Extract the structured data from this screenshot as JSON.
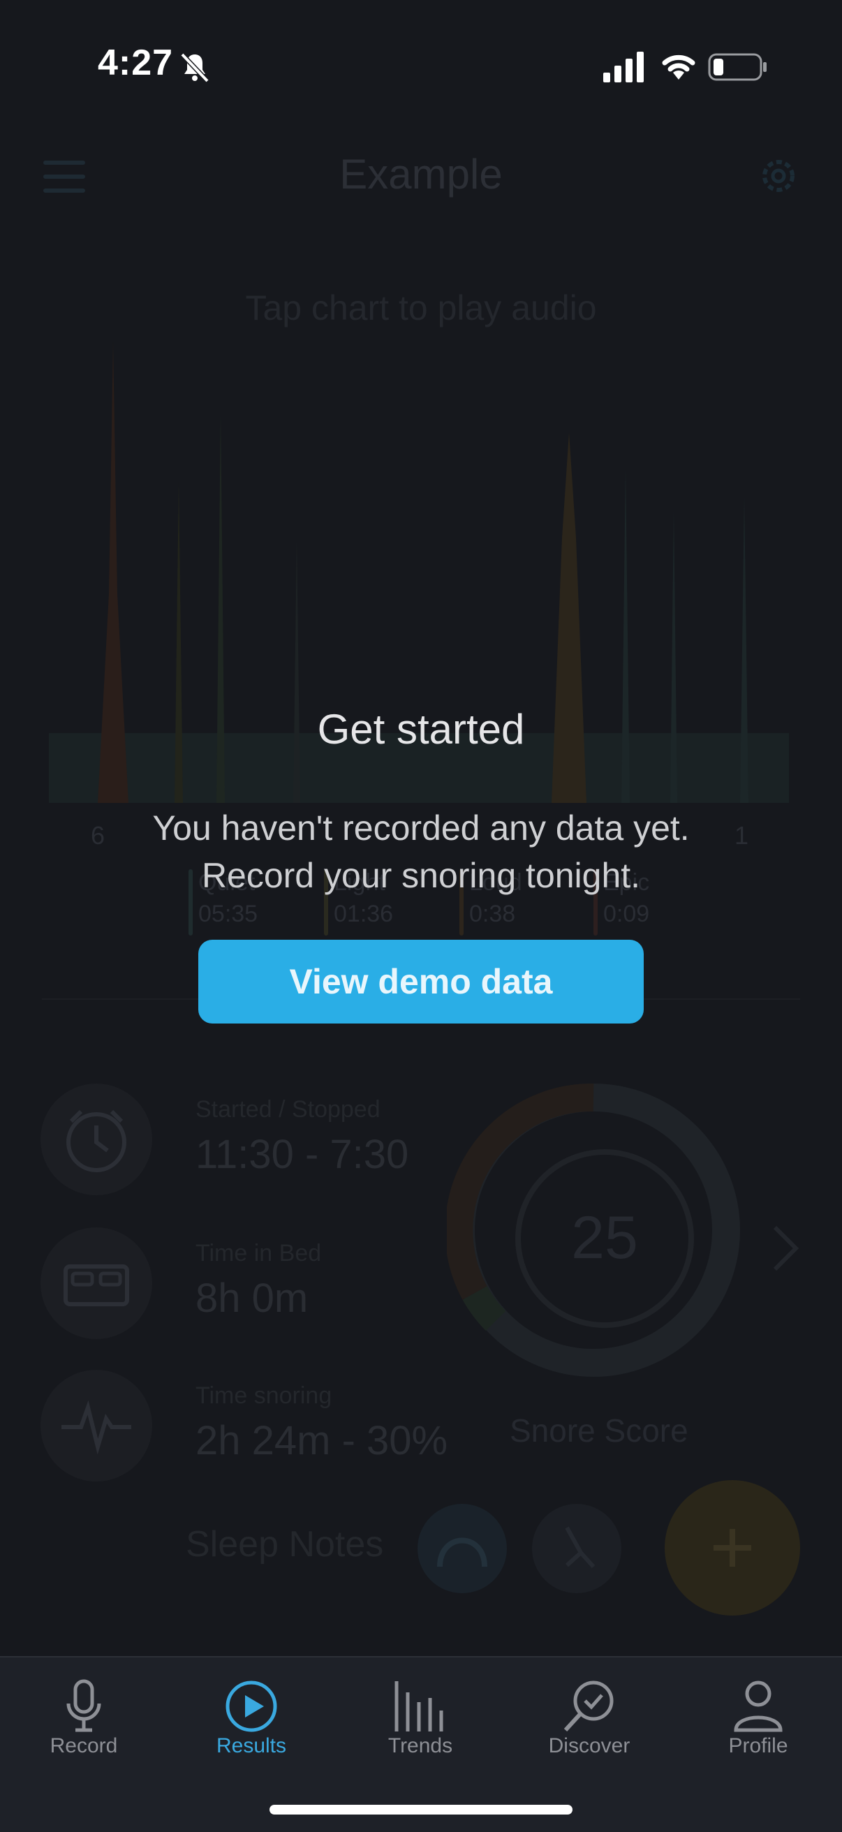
{
  "status_bar": {
    "time": "4:27"
  },
  "header": {
    "title": "Example"
  },
  "chart": {
    "hint": "Tap chart to play audio",
    "axis_start": "6",
    "axis_end": "1"
  },
  "legend": [
    {
      "name": "Quiet",
      "value": "05:35",
      "color": "#1f2c2e"
    },
    {
      "name": "Light",
      "value": "01:36",
      "color": "#2a2a1f"
    },
    {
      "name": "Loud",
      "value": "0:38",
      "color": "#2d251c"
    },
    {
      "name": "Epic",
      "value": "0:09",
      "color": "#2d1f1f"
    }
  ],
  "stats": [
    {
      "label": "Started / Stopped",
      "value": "11:30 - 7:30",
      "icon": "alarm-clock-icon"
    },
    {
      "label": "Time in Bed",
      "value": "8h 0m",
      "icon": "bed-icon"
    },
    {
      "label": "Time snoring",
      "value": "2h 24m - 30%",
      "icon": "heartbeat-icon"
    }
  ],
  "score": {
    "value": "25",
    "caption": "Snore Score"
  },
  "notes": {
    "label": "Sleep Notes"
  },
  "overlay": {
    "title": "Get started",
    "line1": "You haven't recorded any data yet.",
    "line2": "Record your snoring tonight.",
    "button": "View demo data"
  },
  "tabs": [
    {
      "label": "Record",
      "icon": "microphone-icon",
      "active": false
    },
    {
      "label": "Results",
      "icon": "play-circle-icon",
      "active": true
    },
    {
      "label": "Trends",
      "icon": "bars-icon",
      "active": false
    },
    {
      "label": "Discover",
      "icon": "magnifier-check-icon",
      "active": false
    },
    {
      "label": "Profile",
      "icon": "person-icon",
      "active": false
    }
  ],
  "colors": {
    "accent": "#2aaee6",
    "background": "#16181d",
    "tab_active": "#3aa9e0"
  }
}
